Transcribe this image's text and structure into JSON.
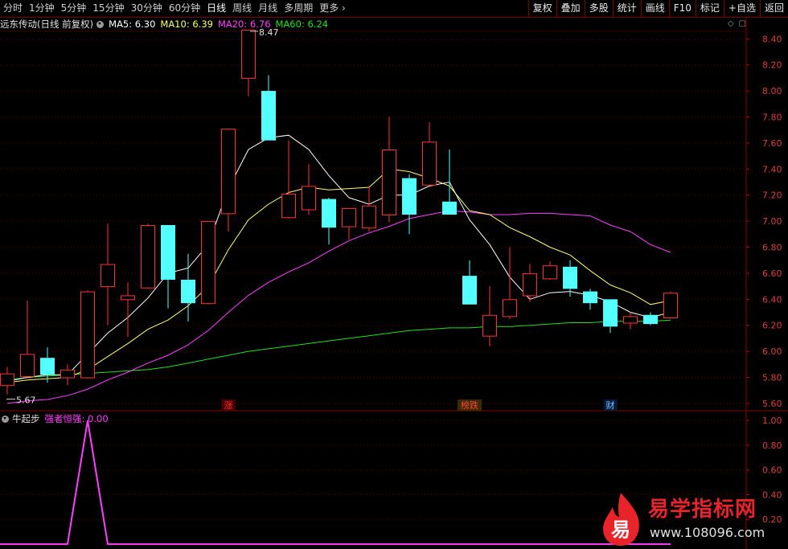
{
  "toolbar": {
    "periods": [
      "分时",
      "1分钟",
      "5分钟",
      "15分钟",
      "30分钟",
      "60分钟",
      "日线",
      "周线",
      "月线",
      "多周期",
      "更多"
    ],
    "active_period": "日线",
    "right_buttons": [
      "复权",
      "叠加",
      "多股",
      "统计",
      "画线",
      "F10",
      "标记",
      "+自选",
      "返回"
    ]
  },
  "legend": {
    "title": "远东传动(日线 前复权)",
    "ma5": "MA5: 6.30",
    "ma10": "MA10: 6.39",
    "ma20": "MA20: 6.76",
    "ma60": "MA60: 6.24",
    "colors": {
      "ma5": "#ffffff",
      "ma10": "#ffff66",
      "ma20": "#ff40ff",
      "ma60": "#20e020"
    }
  },
  "sub_legend": {
    "title": "牛起步",
    "indicator": "强者恒强: 0.00",
    "color": "#ff40ff"
  },
  "annotations": {
    "high": "8.47",
    "low": "5.67"
  },
  "event_tags": [
    {
      "text": "涨",
      "color": "#ff3030",
      "bg": "#4a0000",
      "index": 11
    },
    {
      "text": "榜跌",
      "color": "#ff4040",
      "bg": "#3a2a00",
      "index": 23
    },
    {
      "text": "财",
      "color": "#80c0ff",
      "bg": "#001a3a",
      "index": 30
    }
  ],
  "watermark": {
    "logo_char": "易",
    "title": "易学指标网",
    "url": "www.108096.com"
  },
  "chart_data": {
    "type": "candlestick",
    "y_ticks": [
      "8.40",
      "8.20",
      "8.00",
      "7.80",
      "7.60",
      "7.40",
      "7.20",
      "7.00",
      "6.80",
      "6.60",
      "6.40",
      "6.20",
      "6.00",
      "5.80",
      "5.60"
    ],
    "ylim": [
      5.55,
      8.55
    ],
    "candles": [
      {
        "o": 5.74,
        "c": 5.83,
        "h": 5.88,
        "l": 5.67
      },
      {
        "o": 5.81,
        "c": 5.98,
        "h": 6.39,
        "l": 5.79
      },
      {
        "o": 5.95,
        "c": 5.82,
        "h": 6.03,
        "l": 5.76
      },
      {
        "o": 5.8,
        "c": 5.86,
        "h": 5.9,
        "l": 5.74
      },
      {
        "o": 5.8,
        "c": 6.46,
        "h": 6.47,
        "l": 5.79
      },
      {
        "o": 6.5,
        "c": 6.67,
        "h": 6.98,
        "l": 6.2
      },
      {
        "o": 6.4,
        "c": 6.43,
        "h": 6.53,
        "l": 6.11
      },
      {
        "o": 6.49,
        "c": 6.97,
        "h": 6.98,
        "l": 6.48
      },
      {
        "o": 6.97,
        "c": 6.55,
        "h": 6.97,
        "l": 6.33
      },
      {
        "o": 6.55,
        "c": 6.37,
        "h": 6.75,
        "l": 6.23
      },
      {
        "o": 6.37,
        "c": 7.0,
        "h": 7.0,
        "l": 6.36
      },
      {
        "o": 7.06,
        "c": 7.71,
        "h": 7.71,
        "l": 6.92
      },
      {
        "o": 8.1,
        "c": 8.47,
        "h": 8.47,
        "l": 7.96
      },
      {
        "o": 8.0,
        "c": 7.62,
        "h": 8.12,
        "l": 7.62
      },
      {
        "o": 7.03,
        "c": 7.21,
        "h": 7.62,
        "l": 7.02
      },
      {
        "o": 7.09,
        "c": 7.27,
        "h": 7.44,
        "l": 7.05
      },
      {
        "o": 7.17,
        "c": 6.95,
        "h": 7.18,
        "l": 6.82
      },
      {
        "o": 6.96,
        "c": 7.1,
        "h": 7.1,
        "l": 6.86
      },
      {
        "o": 6.95,
        "c": 7.12,
        "h": 7.27,
        "l": 6.92
      },
      {
        "o": 7.05,
        "c": 7.55,
        "h": 7.8,
        "l": 6.99
      },
      {
        "o": 7.33,
        "c": 7.05,
        "h": 7.36,
        "l": 6.9
      },
      {
        "o": 7.28,
        "c": 7.61,
        "h": 7.76,
        "l": 7.27
      },
      {
        "o": 7.15,
        "c": 7.05,
        "h": 7.55,
        "l": 7.05
      },
      {
        "o": 6.58,
        "c": 6.36,
        "h": 6.7,
        "l": 6.36
      },
      {
        "o": 6.12,
        "c": 6.28,
        "h": 6.5,
        "l": 6.04
      },
      {
        "o": 6.27,
        "c": 6.4,
        "h": 6.8,
        "l": 6.25
      },
      {
        "o": 6.43,
        "c": 6.6,
        "h": 6.67,
        "l": 6.38
      },
      {
        "o": 6.56,
        "c": 6.66,
        "h": 6.69,
        "l": 6.55
      },
      {
        "o": 6.65,
        "c": 6.48,
        "h": 6.7,
        "l": 6.42
      },
      {
        "o": 6.46,
        "c": 6.37,
        "h": 6.48,
        "l": 6.32
      },
      {
        "o": 6.4,
        "c": 6.19,
        "h": 6.4,
        "l": 6.14
      },
      {
        "o": 6.22,
        "c": 6.27,
        "h": 6.3,
        "l": 6.17
      },
      {
        "o": 6.28,
        "c": 6.21,
        "h": 6.3,
        "l": 6.2
      },
      {
        "o": 6.26,
        "c": 6.45,
        "h": 6.46,
        "l": 6.25
      }
    ],
    "ma5": [
      5.77,
      5.8,
      5.82,
      5.82,
      5.98,
      6.14,
      6.26,
      6.41,
      6.6,
      6.64,
      6.82,
      7.25,
      7.55,
      7.64,
      7.66,
      7.55,
      7.35,
      7.18,
      7.13,
      7.2,
      7.2,
      7.27,
      7.3,
      7.01,
      6.82,
      6.57,
      6.4,
      6.45,
      6.46,
      6.43,
      6.38,
      6.3,
      6.26,
      6.3
    ],
    "ma10": [
      5.76,
      5.78,
      5.79,
      5.8,
      5.86,
      5.96,
      6.06,
      6.17,
      6.24,
      6.35,
      6.5,
      6.78,
      7.01,
      7.13,
      7.22,
      7.26,
      7.24,
      7.25,
      7.26,
      7.4,
      7.38,
      7.33,
      7.27,
      7.08,
      7.05,
      6.95,
      6.88,
      6.8,
      6.74,
      6.62,
      6.51,
      6.45,
      6.36,
      6.39
    ],
    "ma20": [
      5.6,
      5.62,
      5.63,
      5.66,
      5.71,
      5.78,
      5.84,
      5.91,
      5.97,
      6.05,
      6.16,
      6.3,
      6.43,
      6.53,
      6.61,
      6.68,
      6.77,
      6.85,
      6.91,
      6.96,
      7.02,
      7.05,
      7.08,
      7.07,
      7.05,
      7.05,
      7.06,
      7.06,
      7.05,
      7.04,
      6.97,
      6.92,
      6.82,
      6.76
    ],
    "ma60": [
      5.78,
      5.8,
      5.81,
      5.82,
      5.83,
      5.84,
      5.85,
      5.86,
      5.88,
      5.91,
      5.94,
      5.97,
      6.0,
      6.02,
      6.04,
      6.06,
      6.08,
      6.1,
      6.12,
      6.14,
      6.16,
      6.17,
      6.18,
      6.18,
      6.19,
      6.19,
      6.2,
      6.21,
      6.22,
      6.22,
      6.23,
      6.23,
      6.23,
      6.24
    ],
    "sub": {
      "y_ticks": [
        "1.00",
        "0.80",
        "0.60",
        "0.40",
        "0.20"
      ],
      "ylim": [
        -0.02,
        1.02
      ],
      "values": [
        0,
        0,
        0,
        0,
        1,
        0,
        0,
        0,
        0,
        0,
        0,
        0,
        0,
        0,
        0,
        0,
        0,
        0,
        0,
        0,
        0,
        0,
        0,
        0,
        0,
        0,
        0,
        0,
        0,
        0,
        0,
        0,
        0,
        0
      ]
    }
  }
}
